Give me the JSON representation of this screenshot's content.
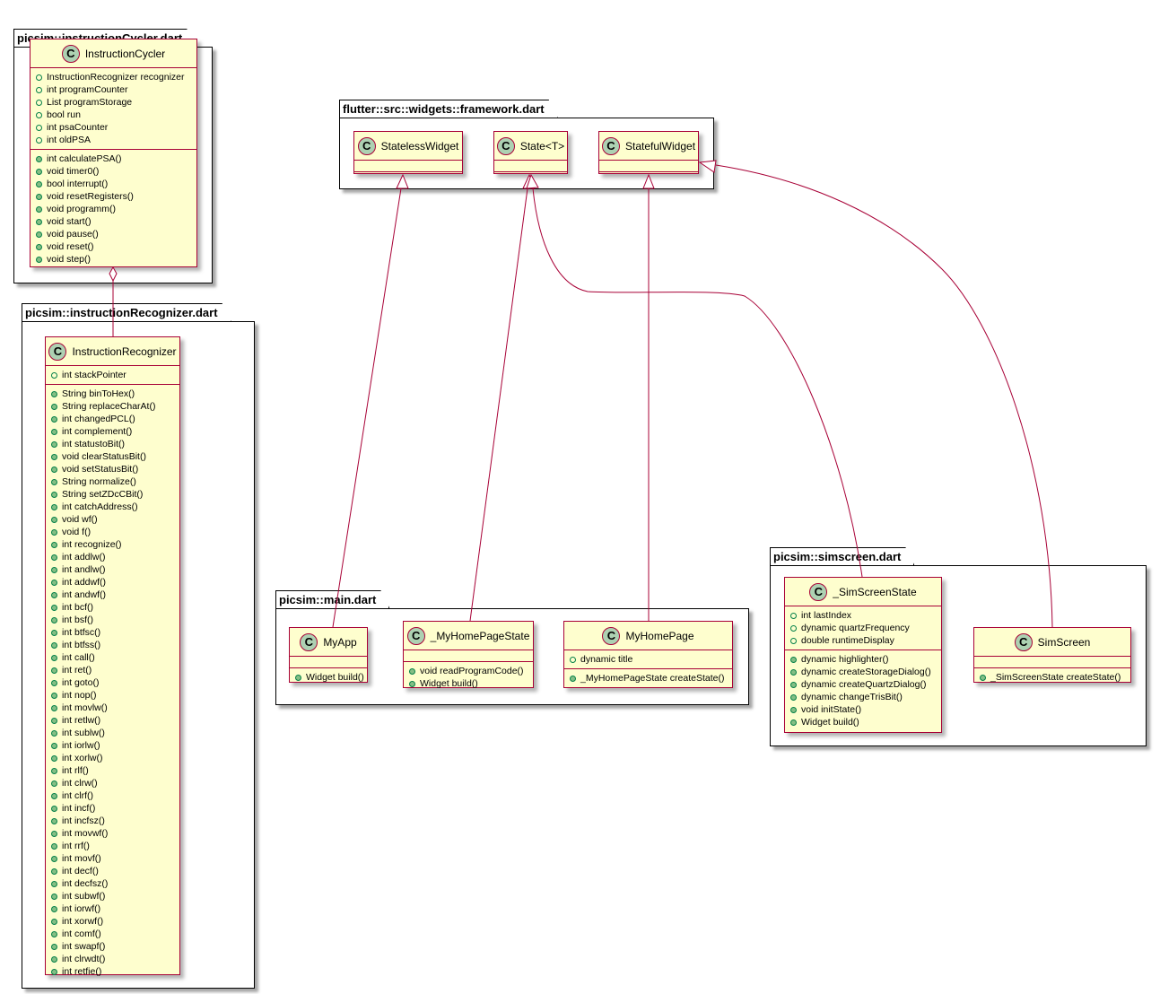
{
  "colors": {
    "class_fill": "#FEFECE",
    "class_border": "#A80036",
    "icon_fill": "#ADD1B2",
    "edge": "#A80036",
    "method_dot": "#84BE84",
    "field_dot_border": "#038048"
  },
  "packages": {
    "cycler": "picsim::instructionCycler.dart",
    "recognizer": "picsim::instructionRecognizer.dart",
    "framework": "flutter::src::widgets::framework.dart",
    "main": "picsim::main.dart",
    "simscreen": "picsim::simscreen.dart"
  },
  "classes": {
    "InstructionCycler": {
      "icon": "C",
      "name": "InstructionCycler",
      "fields": [
        "InstructionRecognizer recognizer",
        "int programCounter",
        "List programStorage",
        "bool run",
        "int psaCounter",
        "int oldPSA"
      ],
      "methods": [
        "int calculatePSA()",
        "void timer0()",
        "bool interrupt()",
        "void resetRegisters()",
        "void programm()",
        "void start()",
        "void pause()",
        "void reset()",
        "void step()"
      ]
    },
    "InstructionRecognizer": {
      "icon": "C",
      "name": "InstructionRecognizer",
      "fields": [
        "int stackPointer"
      ],
      "methods": [
        "String binToHex()",
        "String replaceCharAt()",
        "int changedPCL()",
        "int complement()",
        "int statustoBit()",
        "void clearStatusBit()",
        "void setStatusBit()",
        "String normalize()",
        "String setZDcCBit()",
        "int catchAddress()",
        "void wf()",
        "void f()",
        "int recognize()",
        "int addlw()",
        "int andlw()",
        "int addwf()",
        "int andwf()",
        "int bcf()",
        "int bsf()",
        "int btfsc()",
        "int btfss()",
        "int call()",
        "int ret()",
        "int goto()",
        "int nop()",
        "int movlw()",
        "int retlw()",
        "int sublw()",
        "int iorlw()",
        "int xorlw()",
        "int rlf()",
        "int clrw()",
        "int clrf()",
        "int incf()",
        "int incfsz()",
        "int movwf()",
        "int rrf()",
        "int movf()",
        "int decf()",
        "int decfsz()",
        "int subwf()",
        "int iorwf()",
        "int xorwf()",
        "int comf()",
        "int swapf()",
        "int clrwdt()",
        "int retfie()"
      ]
    },
    "StatelessWidget": {
      "icon": "C",
      "name": "StatelessWidget",
      "fields": [],
      "methods": []
    },
    "State": {
      "icon": "C",
      "name": "State<T>",
      "fields": [],
      "methods": []
    },
    "StatefulWidget": {
      "icon": "C",
      "name": "StatefulWidget",
      "fields": [],
      "methods": []
    },
    "MyApp": {
      "icon": "C",
      "name": "MyApp",
      "fields": [],
      "methods": [
        "Widget build()"
      ]
    },
    "MyHomePageState": {
      "icon": "C",
      "name": "_MyHomePageState",
      "fields": [],
      "methods": [
        "void readProgramCode()",
        "Widget build()"
      ]
    },
    "MyHomePage": {
      "icon": "C",
      "name": "MyHomePage",
      "fields": [
        "dynamic title"
      ],
      "methods": [
        "_MyHomePageState createState()"
      ]
    },
    "SimScreenState": {
      "icon": "C",
      "name": "_SimScreenState",
      "fields": [
        "int lastIndex",
        "dynamic quartzFrequency",
        "double runtimeDisplay"
      ],
      "methods": [
        "dynamic highlighter()",
        "dynamic createStorageDialog()",
        "dynamic createQuartzDialog()",
        "dynamic changeTrisBit()",
        "void initState()",
        "Widget build()"
      ]
    },
    "SimScreen": {
      "icon": "C",
      "name": "SimScreen",
      "fields": [],
      "methods": [
        "_SimScreenState createState()"
      ]
    }
  },
  "relations": [
    {
      "from": "InstructionCycler",
      "to": "InstructionRecognizer",
      "type": "aggregation"
    },
    {
      "from": "MyApp",
      "to": "StatelessWidget",
      "type": "extends"
    },
    {
      "from": "MyHomePageState",
      "to": "State",
      "type": "extends"
    },
    {
      "from": "SimScreenState",
      "to": "State",
      "type": "extends"
    },
    {
      "from": "MyHomePage",
      "to": "StatefulWidget",
      "type": "extends"
    },
    {
      "from": "SimScreen",
      "to": "StatefulWidget",
      "type": "extends"
    }
  ]
}
